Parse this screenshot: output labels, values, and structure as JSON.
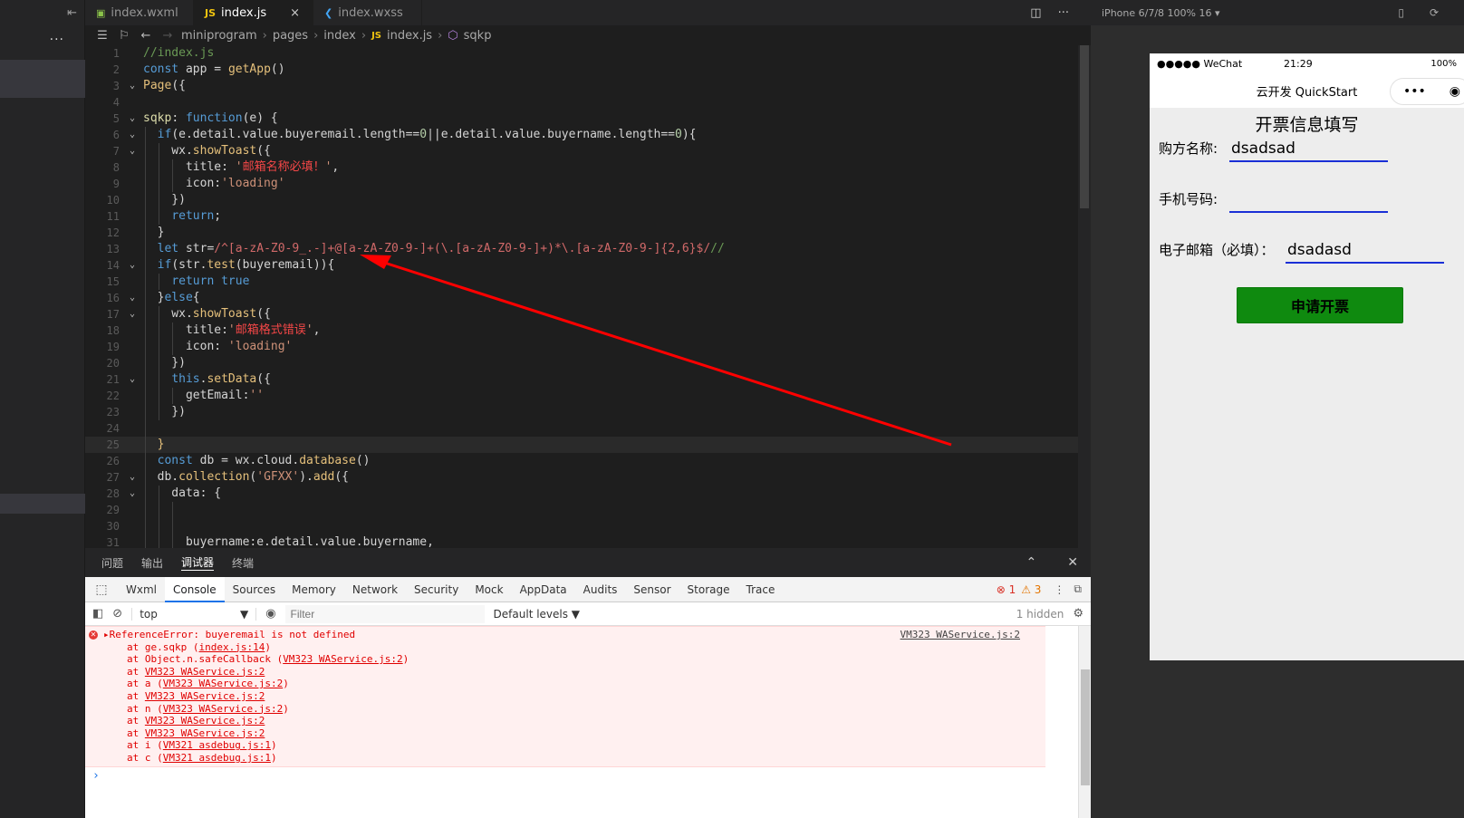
{
  "editor": {
    "tabs": [
      {
        "label": "index.wxml",
        "icon": "wxml-file-icon",
        "active": false
      },
      {
        "label": "index.js",
        "icon": "js-file-icon",
        "active": true
      },
      {
        "label": "index.wxss",
        "icon": "wxss-file-icon",
        "active": false
      }
    ],
    "close_glyph": "×",
    "breadcrumb": [
      "miniprogram",
      "pages",
      "index",
      "index.js",
      "sqkp"
    ],
    "lines": [
      {
        "n": "1",
        "fold": "",
        "hl": false,
        "indent": 0,
        "html": "<span class='c-cm'>//index.js</span>"
      },
      {
        "n": "2",
        "fold": "",
        "hl": false,
        "indent": 0,
        "html": "<span class='c-kw'>const</span> app = <span class='c-fn'>getApp</span>()"
      },
      {
        "n": "3",
        "fold": "v",
        "hl": false,
        "indent": 0,
        "html": "<span class='c-fn'>Page</span>({"
      },
      {
        "n": "4",
        "fold": "",
        "hl": false,
        "indent": 0,
        "html": ""
      },
      {
        "n": "5",
        "fold": "v",
        "hl": false,
        "indent": 0,
        "html": "<span class='c-yl'>sqkp</span>: <span class='c-kw'>function</span>(e) {"
      },
      {
        "n": "6",
        "fold": "v",
        "hl": false,
        "indent": 1,
        "html": "  <span class='c-kw'>if</span>(e.detail.value.buyeremail.length==<span class='c-num'>0</span>||e.detail.value.buyername.length==<span class='c-num'>0</span>){"
      },
      {
        "n": "7",
        "fold": "v",
        "hl": false,
        "indent": 2,
        "html": "    wx.<span class='c-fn'>showToast</span>({"
      },
      {
        "n": "8",
        "fold": "",
        "hl": false,
        "indent": 3,
        "html": "      title: <span class='c-str'>'</span><span class='c-red'>邮箱名称必填！</span><span class='c-str'>'</span>,"
      },
      {
        "n": "9",
        "fold": "",
        "hl": false,
        "indent": 3,
        "html": "      icon:<span class='c-str'>'loading'</span>"
      },
      {
        "n": "10",
        "fold": "",
        "hl": false,
        "indent": 2,
        "html": "    })"
      },
      {
        "n": "11",
        "fold": "",
        "hl": false,
        "indent": 2,
        "html": "    <span class='c-kw'>return</span>;"
      },
      {
        "n": "12",
        "fold": "",
        "hl": false,
        "indent": 1,
        "html": "  }"
      },
      {
        "n": "13",
        "fold": "",
        "hl": false,
        "indent": 1,
        "html": "  <span class='c-kw'>let</span> str=<span class='c-re'>/^[a-zA-Z0-9_.-]+@[a-zA-Z0-9-]+(\\.[a-zA-Z0-9-]+)*\\.[a-zA-Z0-9-]{2,6}$/</span><span class='c-cm'>//</span>"
      },
      {
        "n": "14",
        "fold": "v",
        "hl": false,
        "indent": 1,
        "html": "  <span class='c-kw'>if</span>(str.<span class='c-fn'>test</span>(buyeremail)){"
      },
      {
        "n": "15",
        "fold": "",
        "hl": false,
        "indent": 2,
        "html": "    <span class='c-kw'>return</span> <span class='c-kw'>true</span>"
      },
      {
        "n": "16",
        "fold": "v",
        "hl": false,
        "indent": 1,
        "html": "  }<span class='c-kw'>else</span>{"
      },
      {
        "n": "17",
        "fold": "v",
        "hl": false,
        "indent": 2,
        "html": "    wx.<span class='c-fn'>showToast</span>({"
      },
      {
        "n": "18",
        "fold": "",
        "hl": false,
        "indent": 3,
        "html": "      title:<span class='c-str'>'</span><span class='c-red'>邮箱格式错误</span><span class='c-str'>'</span>,"
      },
      {
        "n": "19",
        "fold": "",
        "hl": false,
        "indent": 3,
        "html": "      icon: <span class='c-str'>'loading'</span>"
      },
      {
        "n": "20",
        "fold": "",
        "hl": false,
        "indent": 2,
        "html": "    })"
      },
      {
        "n": "21",
        "fold": "v",
        "hl": false,
        "indent": 2,
        "html": "    <span class='c-kw'>this</span>.<span class='c-fn'>setData</span>({"
      },
      {
        "n": "22",
        "fold": "",
        "hl": false,
        "indent": 3,
        "html": "      getEmail:<span class='c-str'>''</span>"
      },
      {
        "n": "23",
        "fold": "",
        "hl": false,
        "indent": 2,
        "html": "    })"
      },
      {
        "n": "24",
        "fold": "",
        "hl": false,
        "indent": 1,
        "html": ""
      },
      {
        "n": "25",
        "fold": "",
        "hl": true,
        "indent": 1,
        "html": "  <span class='c-fn'>}</span>"
      },
      {
        "n": "26",
        "fold": "",
        "hl": false,
        "indent": 1,
        "html": "  <span class='c-kw'>const</span> db = wx.cloud.<span class='c-fn'>database</span>()"
      },
      {
        "n": "27",
        "fold": "v",
        "hl": false,
        "indent": 1,
        "html": "  db.<span class='c-fn'>collection</span>(<span class='c-str'>'GFXX'</span>).<span class='c-fn'>add</span>({"
      },
      {
        "n": "28",
        "fold": "v",
        "hl": false,
        "indent": 2,
        "html": "    data: {"
      },
      {
        "n": "29",
        "fold": "",
        "hl": false,
        "indent": 3,
        "html": ""
      },
      {
        "n": "30",
        "fold": "",
        "hl": false,
        "indent": 3,
        "html": ""
      },
      {
        "n": "31",
        "fold": "",
        "hl": false,
        "indent": 3,
        "html": "      buyername:e.detail.value.buyername,"
      }
    ]
  },
  "panel": {
    "tabs": [
      "问题",
      "输出",
      "调试器",
      "终端"
    ],
    "active_tab": "调试器",
    "devtools_tabs": [
      "Wxml",
      "Console",
      "Sources",
      "Memory",
      "Network",
      "Security",
      "Mock",
      "AppData",
      "Audits",
      "Sensor",
      "Storage",
      "Trace"
    ],
    "active_devtool": "Console",
    "error_count": "1",
    "warning_count": "3",
    "context": "top",
    "filter_placeholder": "Filter",
    "levels": "Default levels ▼",
    "hidden": "1 hidden",
    "error": {
      "message": "ReferenceError: buyeremail is not defined",
      "source": "VM323 WAService.js:2",
      "stack": [
        {
          "pre": "at ge.sqkp (",
          "link": "index.js:14",
          "post": ")"
        },
        {
          "pre": "at Object.n.safeCallback (",
          "link": "VM323 WAService.js:2",
          "post": ")"
        },
        {
          "pre": "at ",
          "link": "VM323 WAService.js:2",
          "post": ""
        },
        {
          "pre": "at a (",
          "link": "VM323 WAService.js:2",
          "post": ")"
        },
        {
          "pre": "at ",
          "link": "VM323 WAService.js:2",
          "post": ""
        },
        {
          "pre": "at n (",
          "link": "VM323 WAService.js:2",
          "post": ")"
        },
        {
          "pre": "at ",
          "link": "VM323 WAService.js:2",
          "post": ""
        },
        {
          "pre": "at ",
          "link": "VM323 WAService.js:2",
          "post": ""
        },
        {
          "pre": "at i (",
          "link": "VM321 asdebug.js:1",
          "post": ")"
        },
        {
          "pre": "at c (",
          "link": "VM321 asdebug.js:1",
          "post": ")"
        }
      ]
    }
  },
  "simulator": {
    "device": "iPhone 6/7/8 100% 16 ▾",
    "carrier": "●●●●● WeChat",
    "time": "21:29",
    "battery": "100%",
    "nav_title": "云开发 QuickStart",
    "form_title": "开票信息填写",
    "buyer_name_label": "购方名称:",
    "buyer_name_value": "dsadsad",
    "phone_label": "手机号码:",
    "phone_value": "",
    "email_label": "电子邮箱（必填）：",
    "email_value": "dsadasd",
    "submit_label": "申请开票",
    "submit_color": "#0f8a0f"
  },
  "annotation": {
    "arrow_color": "#ff0000"
  }
}
